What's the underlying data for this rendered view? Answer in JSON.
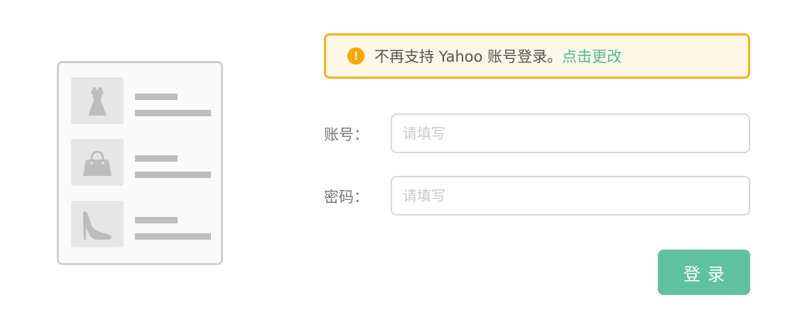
{
  "illustration": {
    "items": [
      {
        "icon": "dress-icon"
      },
      {
        "icon": "handbag-icon"
      },
      {
        "icon": "high-heel-icon"
      }
    ]
  },
  "notice": {
    "icon_glyph": "!",
    "text": "不再支持 Yahoo 账号登录。",
    "link_label": "点击更改",
    "colors": {
      "border": "#f4b41a",
      "background": "#fef6e6",
      "link": "#4dbb98"
    }
  },
  "form": {
    "account_label": "账号：",
    "account_placeholder": "请填写",
    "account_value": "",
    "password_label": "密码：",
    "password_placeholder": "请填写",
    "password_value": "",
    "submit_label": "登录"
  },
  "colors": {
    "accent": "#5fc1a0"
  }
}
